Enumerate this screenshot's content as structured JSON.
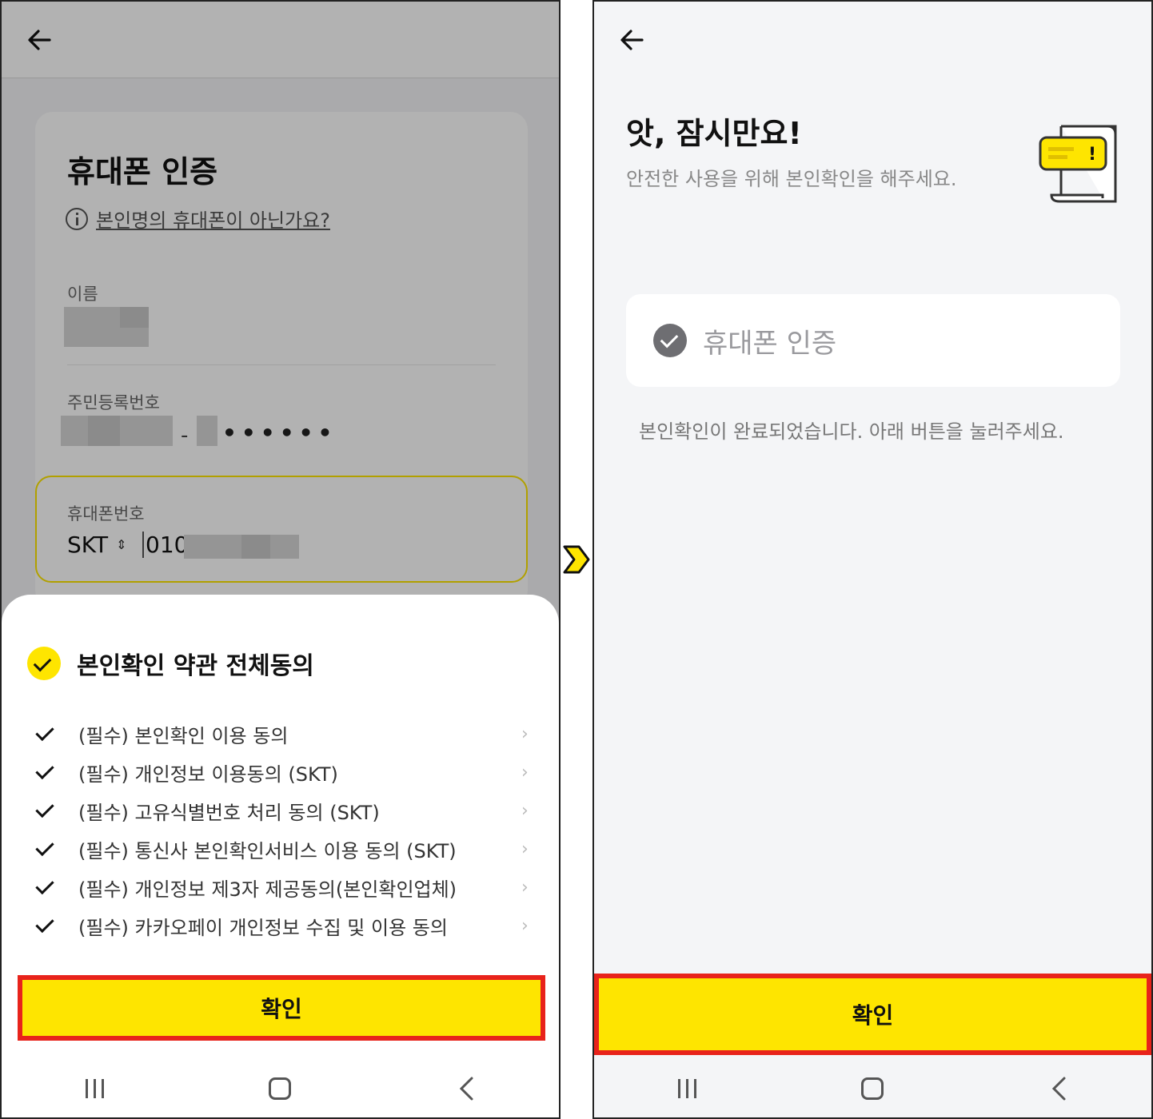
{
  "left": {
    "title": "휴대폰 인증",
    "not_my_phone_link": "본인명의 휴대폰이 아닌가요?",
    "name_label": "이름",
    "rrn_label": "주민등록번호",
    "rrn_dash": "-",
    "rrn_masked": "••••••",
    "phone_label": "휴대폰번호",
    "carrier": "SKT",
    "phone_prefix": "010",
    "agree_all": "본인확인 약관 전체동의",
    "terms": [
      "(필수) 본인확인 이용 동의",
      "(필수) 개인정보 이용동의 (SKT)",
      "(필수) 고유식별번호 처리 동의 (SKT)",
      "(필수) 통신사 본인확인서비스 이용 동의 (SKT)",
      "(필수) 개인정보 제3자 제공동의(본인확인업체)",
      "(필수) 카카오페이 개인정보 수집 및 이용 동의"
    ],
    "confirm": "확인"
  },
  "right": {
    "title": "앗, 잠시만요!",
    "subtitle": "안전한 사용을 위해 본인확인을 해주세요.",
    "verify_item": "휴대폰 인증",
    "done_message": "본인확인이 완료되었습니다. 아래 버튼을 눌러주세요.",
    "confirm": "확인"
  },
  "colors": {
    "accent": "#fee500",
    "highlight_border": "#e8231b"
  }
}
